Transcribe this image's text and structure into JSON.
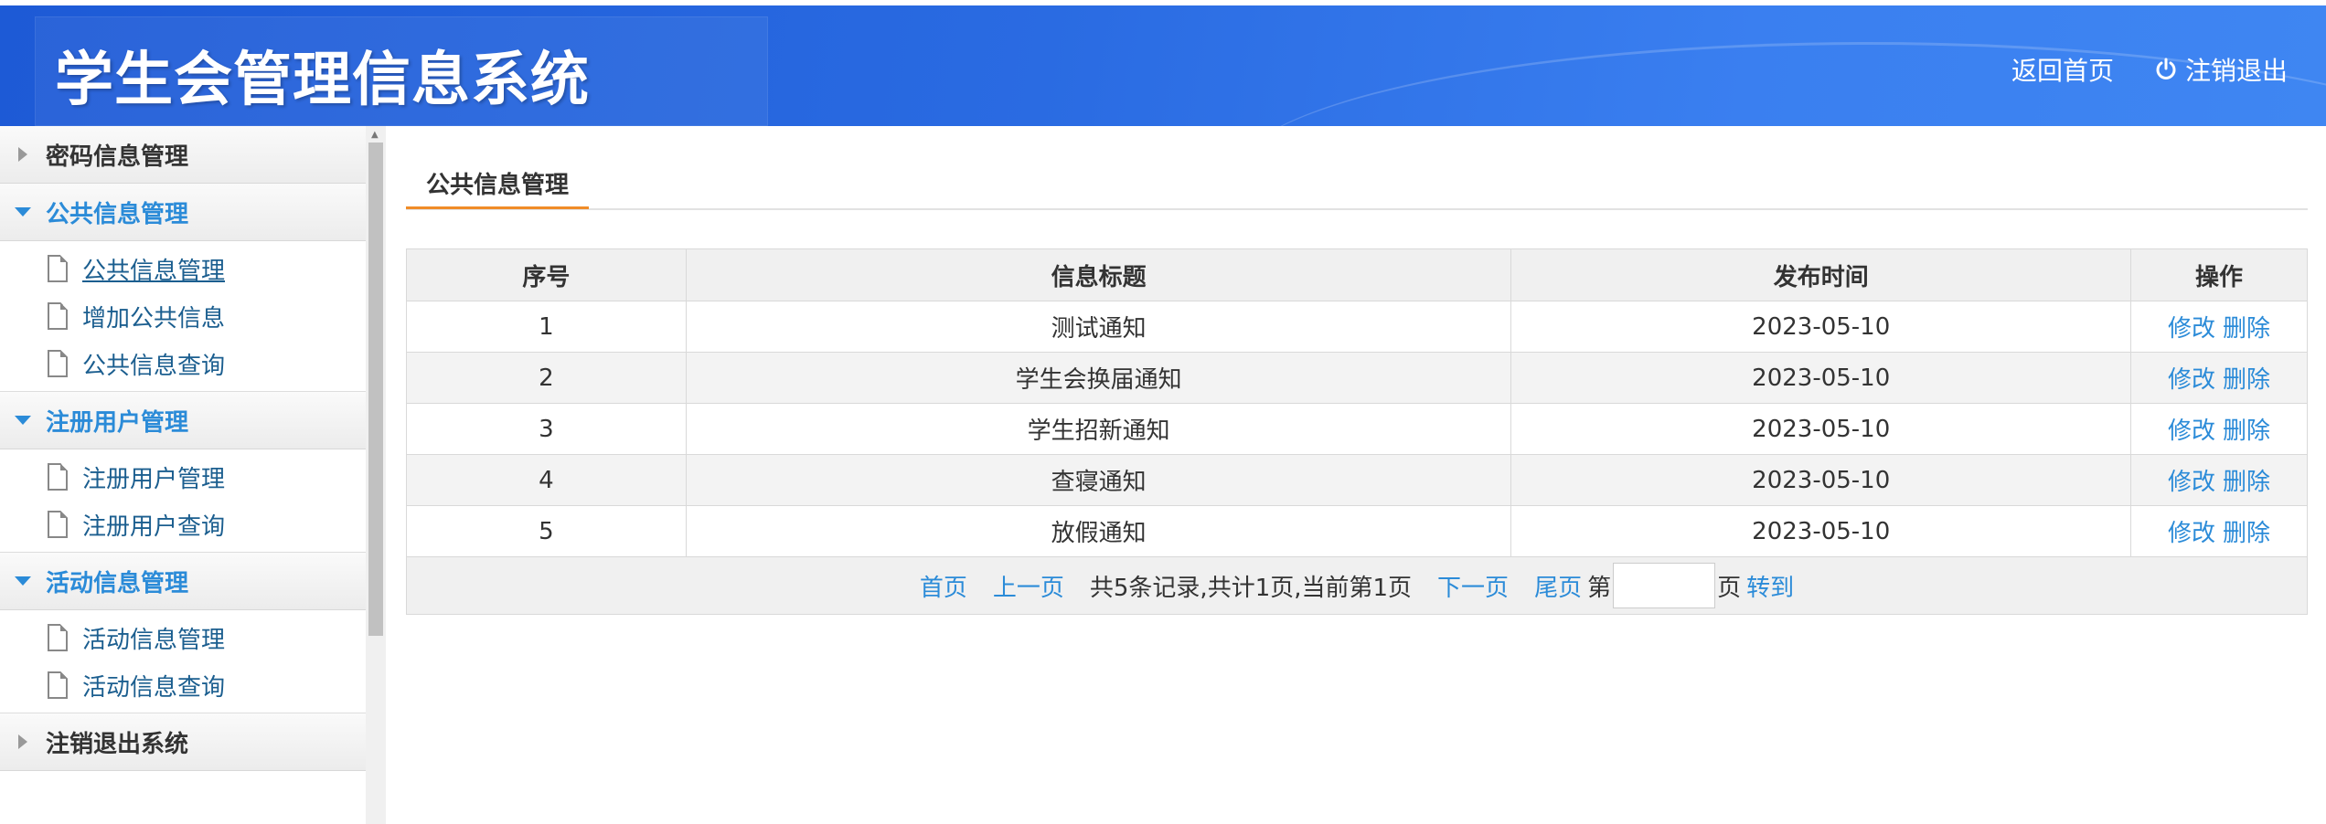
{
  "header": {
    "title": "学生会管理信息系统",
    "home_link": "返回首页",
    "logout_link": "注销退出"
  },
  "sidebar": {
    "groups": [
      {
        "label": "密码信息管理",
        "expanded": false,
        "items": []
      },
      {
        "label": "公共信息管理",
        "expanded": true,
        "items": [
          "公共信息管理",
          "增加公共信息",
          "公共信息查询"
        ]
      },
      {
        "label": "注册用户管理",
        "expanded": true,
        "items": [
          "注册用户管理",
          "注册用户查询"
        ]
      },
      {
        "label": "活动信息管理",
        "expanded": true,
        "items": [
          "活动信息管理",
          "活动信息查询"
        ]
      },
      {
        "label": "注销退出系统",
        "expanded": false,
        "items": []
      }
    ]
  },
  "main": {
    "tab_label": "公共信息管理",
    "table": {
      "headers": [
        "序号",
        "信息标题",
        "发布时间",
        "操作"
      ],
      "rows": [
        {
          "no": "1",
          "title": "测试通知",
          "date": "2023-05-10"
        },
        {
          "no": "2",
          "title": "学生会换届通知",
          "date": "2023-05-10"
        },
        {
          "no": "3",
          "title": "学生招新通知",
          "date": "2023-05-10"
        },
        {
          "no": "4",
          "title": "查寝通知",
          "date": "2023-05-10"
        },
        {
          "no": "5",
          "title": "放假通知",
          "date": "2023-05-10"
        }
      ],
      "edit_label": "修改",
      "delete_label": "删除"
    },
    "pager": {
      "first": "首页",
      "prev": "上一页",
      "summary": "共5条记录,共计1页,当前第1页",
      "next": "下一页",
      "last": "尾页",
      "goto_prefix": "第",
      "goto_suffix": "页",
      "goto_button": "转到",
      "page_input_value": ""
    }
  },
  "colors": {
    "header_blue": "#2a6be2",
    "link_blue": "#2b8bd8",
    "tab_accent": "#f08c28"
  }
}
